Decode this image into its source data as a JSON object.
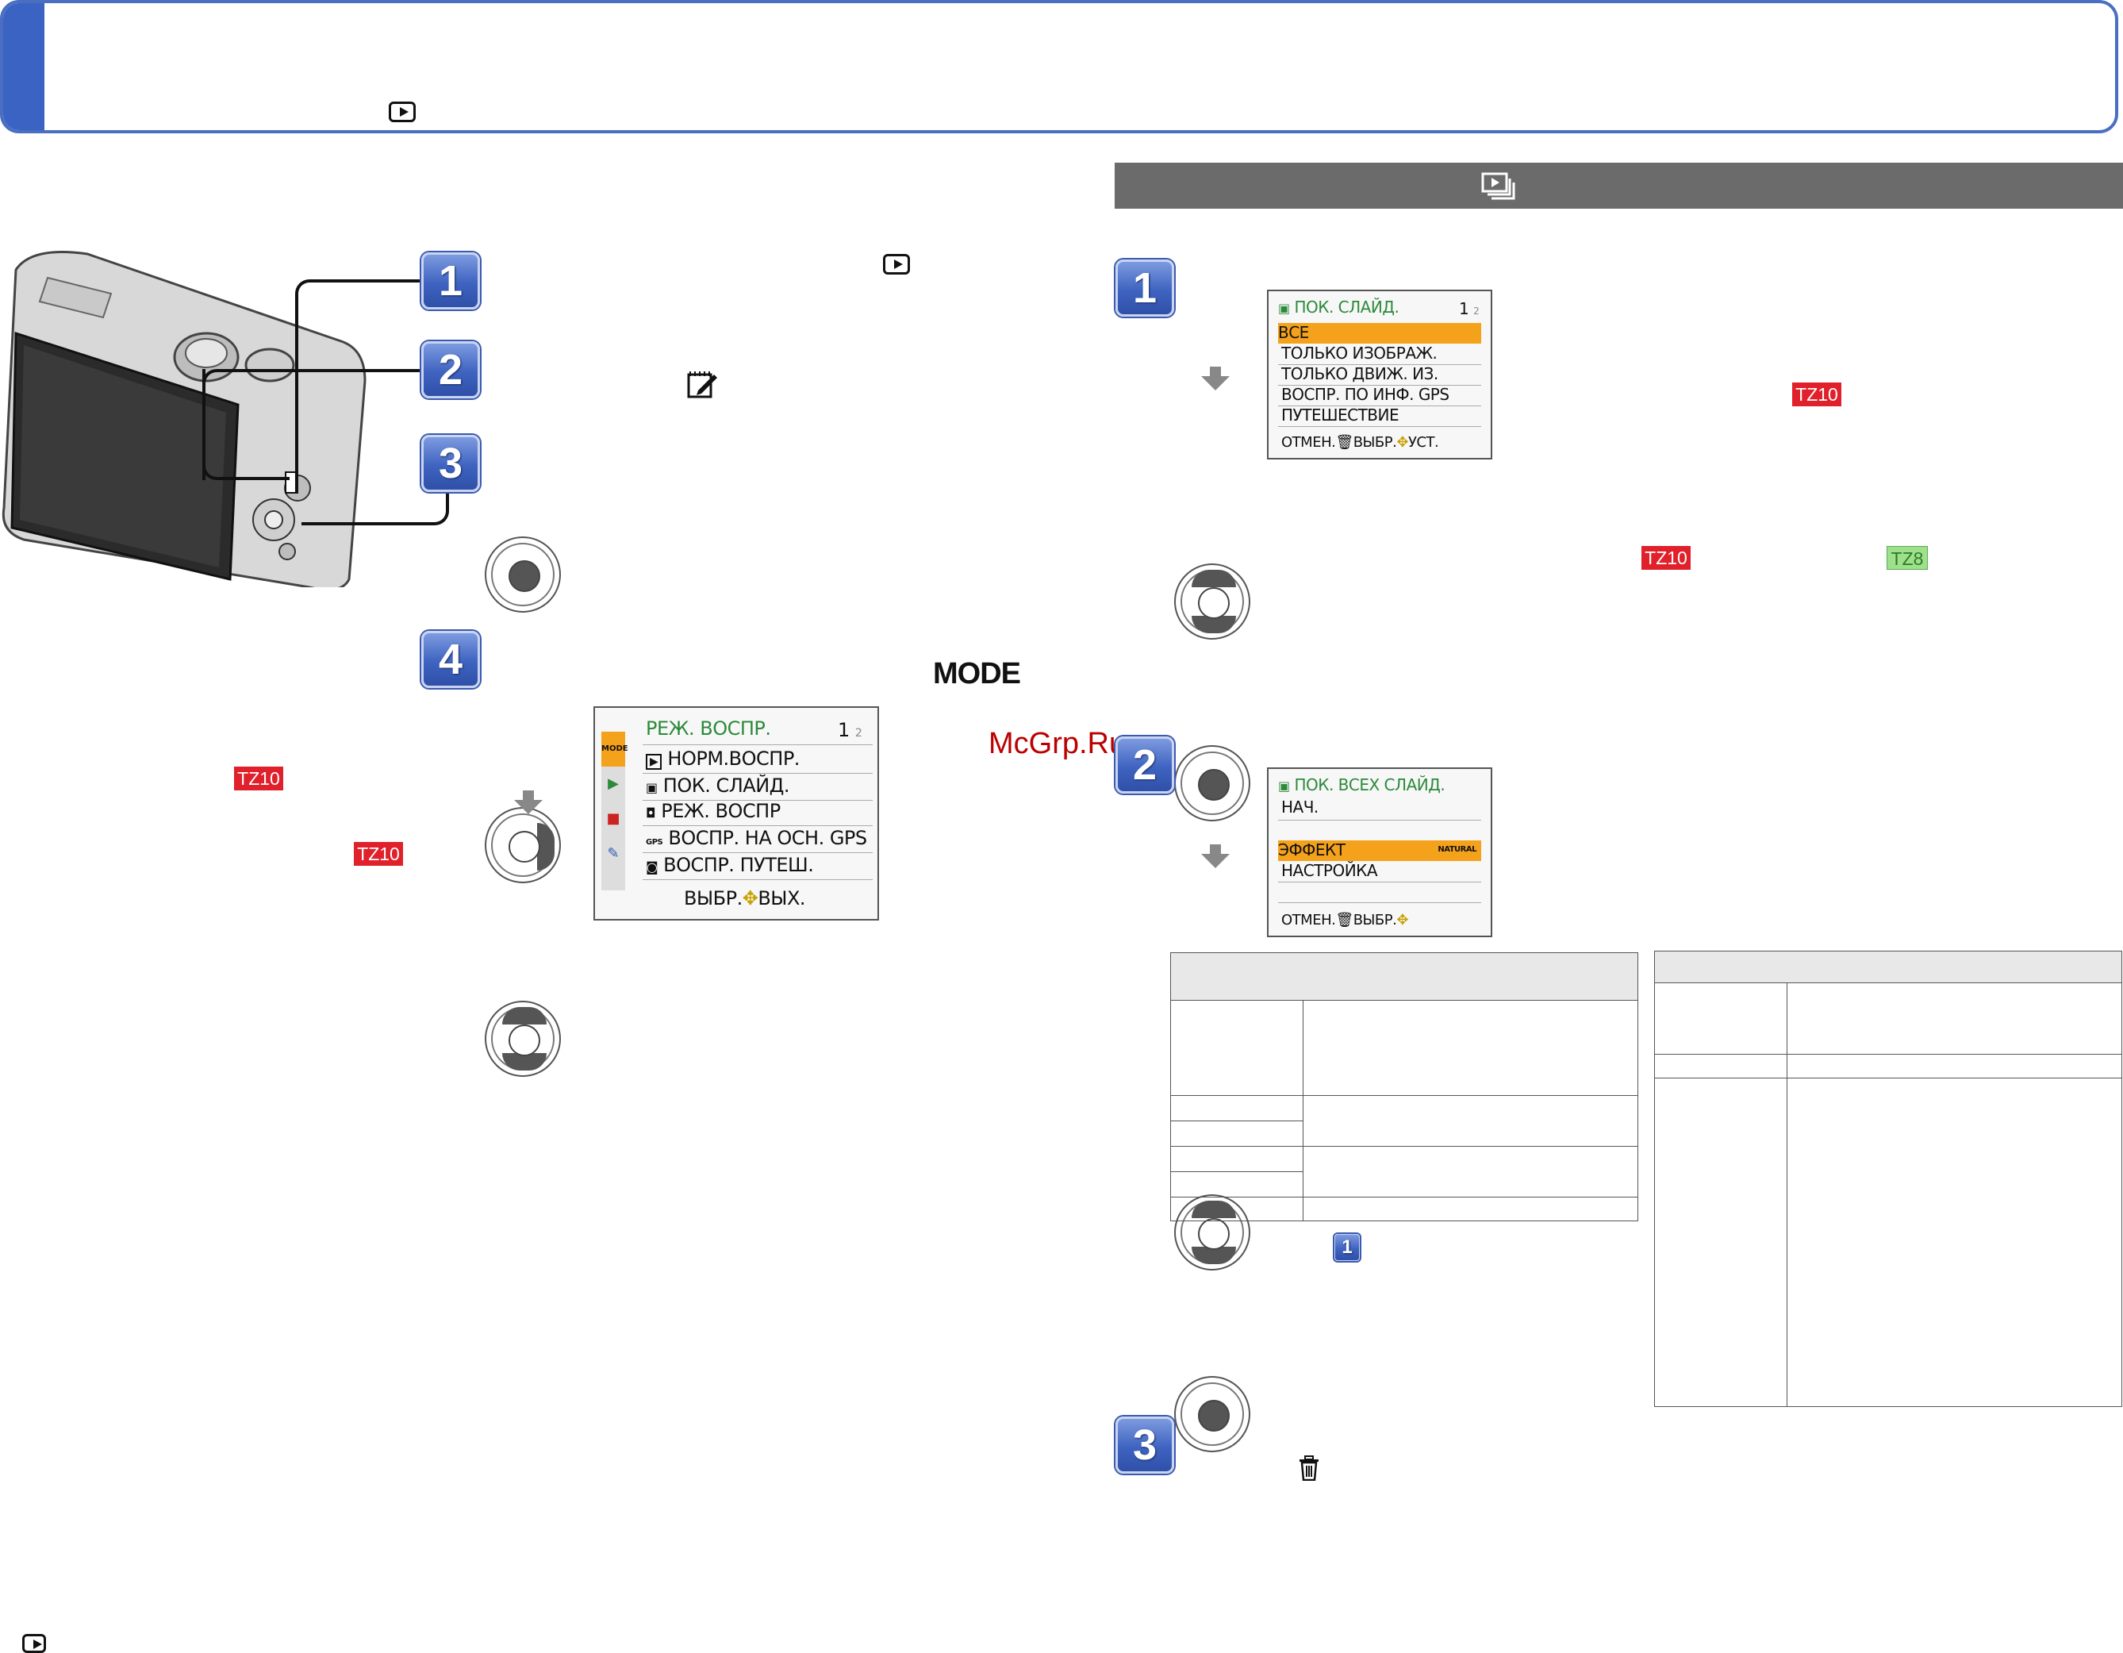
{
  "header": {
    "title_icon": "playback-icon"
  },
  "left": {
    "steps": [
      "1",
      "2",
      "3",
      "4"
    ],
    "mode_label": "MODE",
    "tags": [
      "TZ10",
      "TZ10"
    ]
  },
  "playback_menu": {
    "title": "РЕЖ. ВОСПР.",
    "page": "1",
    "page_total": "2",
    "items": [
      "НОРМ.ВОСПР.",
      "ПОК. СЛАЙД.",
      "РЕЖ. ВОСПР",
      "ВОСПР. НА ОСН. GPS",
      "ВОСПР. ПУТЕШ."
    ],
    "side_tab": "MODE",
    "gps_badge": "GPS",
    "footer_select": "ВЫБР.",
    "footer_exit": "ВЫХ."
  },
  "right": {
    "steps": [
      "1",
      "2",
      "3"
    ],
    "tags": {
      "tz10_a": "TZ10",
      "tz10_b": "TZ10",
      "tz8": "TZ8"
    },
    "inline_step": "1"
  },
  "slideshow_menu": {
    "title": "ПОК. СЛАЙД.",
    "page": "1",
    "page_total": "2",
    "items": [
      "ВСЕ",
      "ТОЛЬКО ИЗОБРАЖ.",
      "ТОЛЬКО ДВИЖ. ИЗ.",
      "ВОСПР. ПО ИНФ. GPS",
      "ПУТЕШЕСТВИЕ"
    ],
    "footer_cancel": "ОТМЕН.",
    "footer_select": "ВЫБР.",
    "footer_set": "УСТ."
  },
  "all_slides_menu": {
    "title": "ПОК. ВСЕХ СЛАЙД.",
    "items": [
      "НАЧ.",
      "",
      "ЭФФЕКТ",
      "НАСТРОЙКА"
    ],
    "effect_value": "NATURAL",
    "footer_cancel": "ОТМЕН.",
    "footer_select": "ВЫБР."
  },
  "watermark": "McGrp.Ru",
  "colors": {
    "accent": "#3a63c4",
    "tag_red": "#e0202a",
    "tag_green": "#9fe08a",
    "highlight": "#f4a11c",
    "banner": "#6b6b6b"
  }
}
